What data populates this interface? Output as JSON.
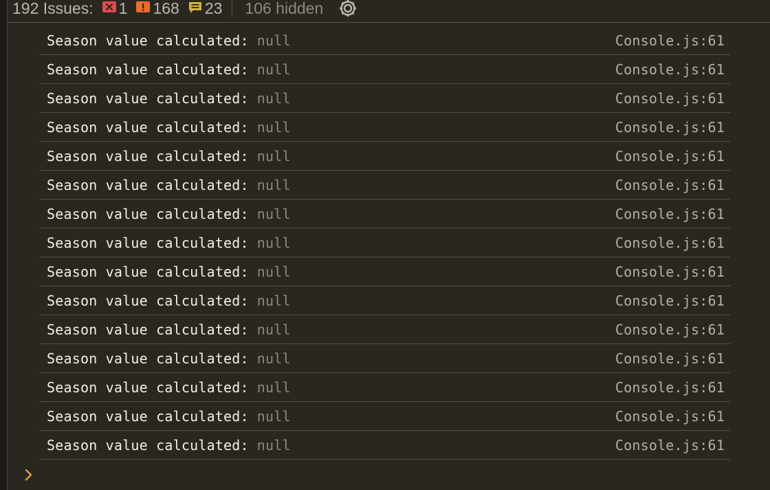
{
  "toolbar": {
    "issues_label": "192 Issues:",
    "errors": "1",
    "warnings": "168",
    "info": "23",
    "hidden": "106 hidden",
    "colors": {
      "error": "#e5484d",
      "warning": "#f26a2b",
      "info": "#d6b43a"
    },
    "icons": [
      "error-icon",
      "warning-icon",
      "info-message-icon",
      "gear-icon"
    ]
  },
  "console": {
    "rows": [
      {
        "message": "Season value calculated:",
        "value": "null",
        "source": "Console.js:61"
      },
      {
        "message": "Season value calculated:",
        "value": "null",
        "source": "Console.js:61"
      },
      {
        "message": "Season value calculated:",
        "value": "null",
        "source": "Console.js:61"
      },
      {
        "message": "Season value calculated:",
        "value": "null",
        "source": "Console.js:61"
      },
      {
        "message": "Season value calculated:",
        "value": "null",
        "source": "Console.js:61"
      },
      {
        "message": "Season value calculated:",
        "value": "null",
        "source": "Console.js:61"
      },
      {
        "message": "Season value calculated:",
        "value": "null",
        "source": "Console.js:61"
      },
      {
        "message": "Season value calculated:",
        "value": "null",
        "source": "Console.js:61"
      },
      {
        "message": "Season value calculated:",
        "value": "null",
        "source": "Console.js:61"
      },
      {
        "message": "Season value calculated:",
        "value": "null",
        "source": "Console.js:61"
      },
      {
        "message": "Season value calculated:",
        "value": "null",
        "source": "Console.js:61"
      },
      {
        "message": "Season value calculated:",
        "value": "null",
        "source": "Console.js:61"
      },
      {
        "message": "Season value calculated:",
        "value": "null",
        "source": "Console.js:61"
      },
      {
        "message": "Season value calculated:",
        "value": "null",
        "source": "Console.js:61"
      },
      {
        "message": "Season value calculated:",
        "value": "null",
        "source": "Console.js:61"
      }
    ]
  },
  "prompt": {
    "icon": "chevron-right-icon",
    "color": "#d6a53a"
  }
}
